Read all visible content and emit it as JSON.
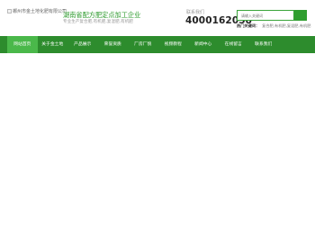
{
  "header": {
    "logo_text": "郴州市金土地化肥有限公司",
    "site_title": "湖南省配方肥定点加工企业",
    "site_slogan": "专业生产复合肥,有机肥,复混肥,有机肥",
    "hotline_label": "联系我们",
    "hotline_number": "4000162058"
  },
  "search": {
    "placeholder": "请输入关键词",
    "hot_label": "热门关键词：",
    "hot_list": "复合肥,有机肥,复混肥,有机肥"
  },
  "nav": {
    "items": [
      {
        "label": "网站首页",
        "active": true
      },
      {
        "label": "关于金土地",
        "active": false
      },
      {
        "label": "产品展示",
        "active": false
      },
      {
        "label": "荣誉资质",
        "active": false
      },
      {
        "label": "厂房厂貌",
        "active": false
      },
      {
        "label": "视频教程",
        "active": false
      },
      {
        "label": "新闻中心",
        "active": false
      },
      {
        "label": "在线留言",
        "active": false
      },
      {
        "label": "联系我们",
        "active": false
      }
    ]
  },
  "colors": {
    "accent": "#2d8c2d",
    "active_nav": "#4ab84a",
    "title_green": "#2c9a2c"
  }
}
